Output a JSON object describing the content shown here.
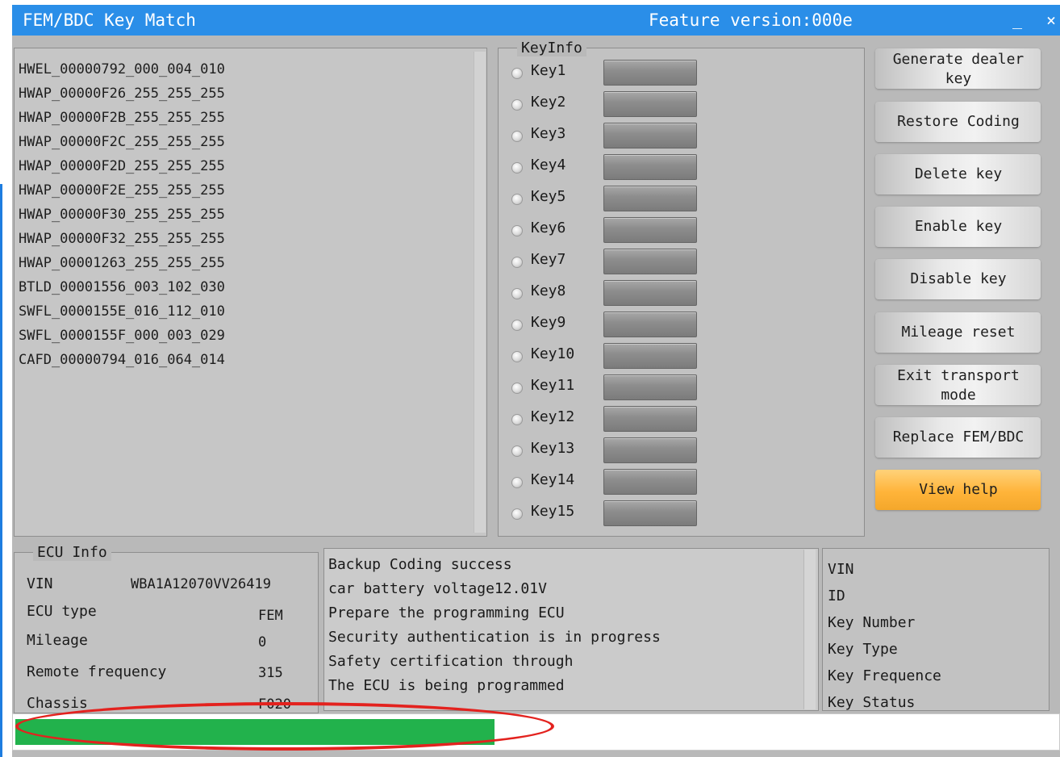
{
  "window": {
    "title": "FEM/BDC Key Match",
    "feature_version": "Feature version:000e",
    "minimize_glyph": "_",
    "close_glyph": "×"
  },
  "module_list": [
    "HWEL_00000792_000_004_010",
    "HWAP_00000F26_255_255_255",
    "HWAP_00000F2B_255_255_255",
    "HWAP_00000F2C_255_255_255",
    "HWAP_00000F2D_255_255_255",
    "HWAP_00000F2E_255_255_255",
    "HWAP_00000F30_255_255_255",
    "HWAP_00000F32_255_255_255",
    "HWAP_00001263_255_255_255",
    "BTLD_00001556_003_102_030",
    "SWFL_0000155E_016_112_010",
    "SWFL_0000155F_000_003_029",
    "CAFD_00000794_016_064_014"
  ],
  "keyinfo": {
    "legend": "KeyInfo",
    "keys": [
      "Key1",
      "Key2",
      "Key3",
      "Key4",
      "Key5",
      "Key6",
      "Key7",
      "Key8",
      "Key9",
      "Key10",
      "Key11",
      "Key12",
      "Key13",
      "Key14",
      "Key15"
    ]
  },
  "actions": [
    {
      "label": "Generate dealer key",
      "highlight": false
    },
    {
      "label": "Restore Coding",
      "highlight": false
    },
    {
      "label": "Delete key",
      "highlight": false
    },
    {
      "label": "Enable key",
      "highlight": false
    },
    {
      "label": "Disable key",
      "highlight": false
    },
    {
      "label": "Mileage reset",
      "highlight": false
    },
    {
      "label": "Exit transport mode",
      "highlight": false
    },
    {
      "label": "Replace FEM/BDC",
      "highlight": false
    },
    {
      "label": "View help",
      "highlight": true
    }
  ],
  "ecu_info": {
    "legend": "ECU Info",
    "vin_label": "VIN",
    "vin": "WBA1A12070VV26419",
    "type_label": "ECU type",
    "type": "FEM",
    "mileage_label": "Mileage",
    "mileage": "0",
    "remote_label": "Remote frequency",
    "remote": "315",
    "chassis_label": "Chassis",
    "chassis": "F020"
  },
  "log_lines": [
    "Backup Coding success",
    "car battery voltage12.01V",
    "Prepare the programming ECU",
    "Security authentication is in progress",
    "Safety certification through",
    "The ECU is being programmed"
  ],
  "key_details": [
    "VIN",
    "ID",
    "Key Number",
    "Key Type",
    "Key Frequence",
    "Key Status"
  ],
  "progress": {
    "percent": 46,
    "fill_color": "#22b24c"
  },
  "colors": {
    "titlebar": "#2a8ee8",
    "annotation": "#e3221e",
    "help_button": "#ffb43a"
  }
}
